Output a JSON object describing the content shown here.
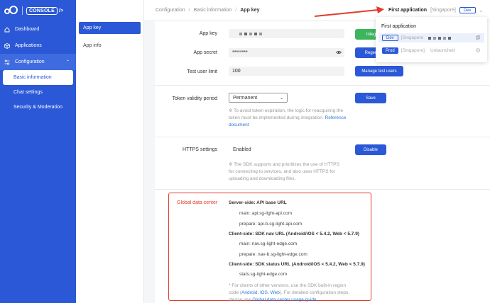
{
  "sidebar": {
    "logo_text": "CONSOLE",
    "items": [
      {
        "label": "Dashboard",
        "icon": "home-icon"
      },
      {
        "label": "Applications",
        "icon": "cube-icon"
      },
      {
        "label": "Configuration",
        "icon": "sliders-icon"
      }
    ],
    "sub_items": [
      {
        "label": "Basic information"
      },
      {
        "label": "Chat settings"
      },
      {
        "label": "Security & Moderation"
      }
    ]
  },
  "subnav": {
    "items": [
      {
        "label": "App key"
      },
      {
        "label": "App info"
      }
    ]
  },
  "header": {
    "breadcrumb": [
      "Configuration",
      "Basic information",
      "App key"
    ],
    "app_name": "First application",
    "app_region": "[Singapore]",
    "app_env": "Dev"
  },
  "popup": {
    "title": "First application",
    "rows": [
      {
        "env": "Dev",
        "region": "[Singapore",
        "status": ""
      },
      {
        "env": "Prod",
        "region": "[Singapore]",
        "status": "Unlaunched"
      }
    ]
  },
  "form": {
    "app_key_label": "App key",
    "app_secret_label": "App secret",
    "app_secret_value": "********",
    "test_user_limit_label": "Test user limit",
    "test_user_limit_value": "100",
    "btn_integrate": "Integ",
    "btn_regenerate": "Regen",
    "btn_manage_test_users": "Manage test users",
    "token_label": "Token validity period",
    "token_select": "Permanent",
    "btn_save": "Save",
    "token_note_1": "※ To avoid token expiration, the logic for reacquiring the",
    "token_note_2": "token must be implemented during integration.",
    "token_note_link": "Reference",
    "token_note_3": "document",
    "https_label": "HTTPS settings",
    "https_value": "Enabled",
    "btn_disable": "Disable",
    "https_note_1": "※ The SDK supports and prioritizes the use of HTTPS",
    "https_note_2": "for connecting to services, and also uses HTTPS for",
    "https_note_3": "uploading and downloading files."
  },
  "gdc": {
    "label": "Global data center",
    "server_title": "Server-side: API base URL",
    "server_main": "main: api.sg-light-api.com",
    "server_prepare": "prepare: api-b.sg-light-api.com",
    "nav_title": "Client-side: SDK nav URL (Android/iOS < 5.4.2, Web < 5.7.9)",
    "nav_main": "main: nav.sg-light-edge.com",
    "nav_prepare": "prepare: nav-b.sg-light-edge.com",
    "status_title": "Client-side: SDK status URL (Android/iOS < 5.4.2, Web < 5.7.9)",
    "status_value": "stats.sg-light-edge.com",
    "note_1": "* For clients of other versions, use the SDK built-in region",
    "note_2a": "code (",
    "link_android": "Android",
    "note_sep": ", ",
    "link_ios": "iOS",
    "link_web": "Web",
    "note_2b": "). For detailed configuration steps,",
    "note_3a": "please see ",
    "link_guide": "Global data center usage guide",
    "note_3b": "."
  },
  "colors": {
    "brand": "#2b58d6",
    "green": "#3cb55c",
    "alert_red": "#e23b2b"
  }
}
